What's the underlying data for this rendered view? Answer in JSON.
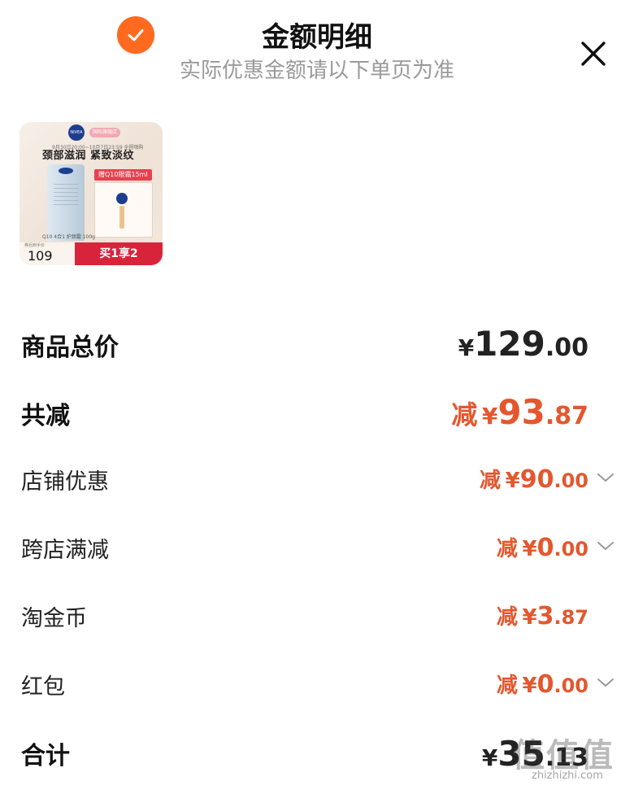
{
  "header": {
    "title": "金额明细",
    "subtitle": "实际优惠金额请以下单页为准",
    "close_icon": "close-icon"
  },
  "product": {
    "brand_logo": "NIVEA",
    "brand_tag": "国际旗舰店",
    "date_text": "9月30日20:00~10月7日23:59 全程嗨购",
    "headline": "颈部滋润 紧致淡纹",
    "gift_tag": "赠Q10眼霜15ml",
    "caption": "Q10 4合1 护颈霜 100g",
    "price_label": "券后到手价",
    "price": "109",
    "promo": "买1享2",
    "selected": true
  },
  "rows": {
    "total": {
      "label": "商品总价",
      "yen": "¥",
      "int": "129",
      "dec": ".00"
    },
    "discount": {
      "label": "共减",
      "prefix": "减",
      "yen": "¥",
      "int": "93",
      "dec": ".87"
    },
    "store": {
      "label": "店铺优惠",
      "prefix": "减",
      "yen": "¥",
      "int": "90",
      "dec": ".00",
      "expandable": true
    },
    "cross": {
      "label": "跨店满减",
      "prefix": "减",
      "yen": "¥",
      "int": "0",
      "dec": ".00",
      "expandable": true
    },
    "coins": {
      "label": "淘金币",
      "prefix": "减",
      "yen": "¥",
      "int": "3",
      "dec": ".87",
      "expandable": false
    },
    "redpacket": {
      "label": "红包",
      "prefix": "减",
      "yen": "¥",
      "int": "0",
      "dec": ".00",
      "expandable": true
    },
    "sum": {
      "label": "合计",
      "yen": "¥",
      "int": "35",
      "dec": ".13"
    }
  },
  "watermark": {
    "text": "值值值",
    "sub": "zhizhizhi.com"
  },
  "colors": {
    "accent": "#e4572e",
    "check": "#ff6a1f",
    "promo": "#d8243a"
  }
}
